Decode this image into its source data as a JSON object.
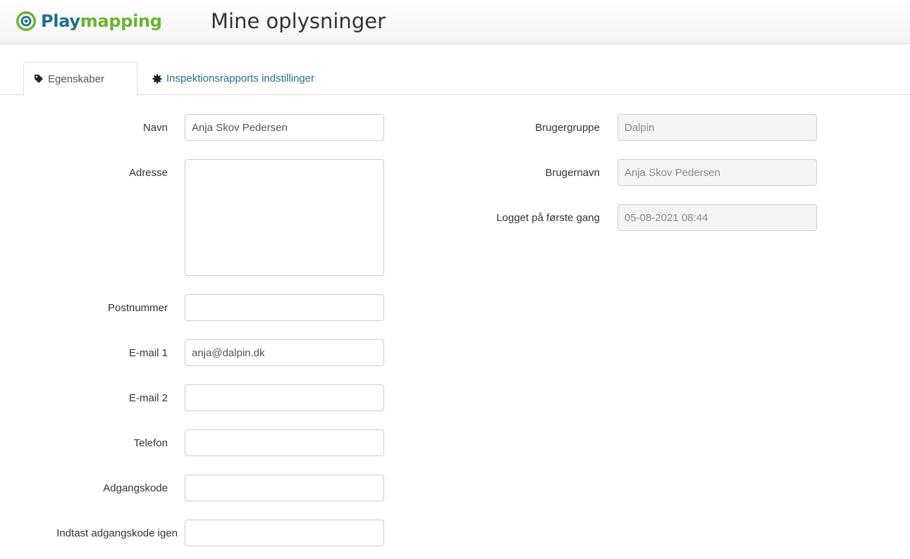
{
  "brand": {
    "part1": "Play",
    "part2": "mapping",
    "color_primary": "#1f6f8b",
    "color_accent": "#6cb332"
  },
  "page_title": "Mine oplysninger",
  "tabs": [
    {
      "label": "Egenskaber",
      "icon": "tag-icon",
      "active": true
    },
    {
      "label": "Inspektionsrapports indstillinger",
      "icon": "gear-icon",
      "active": false
    }
  ],
  "form_left": {
    "navn": {
      "label": "Navn",
      "value": "Anja Skov Pedersen"
    },
    "adresse": {
      "label": "Adresse",
      "value": ""
    },
    "postnummer": {
      "label": "Postnummer",
      "value": ""
    },
    "email1": {
      "label": "E-mail 1",
      "value": "anja@dalpin.dk"
    },
    "email2": {
      "label": "E-mail 2",
      "value": ""
    },
    "telefon": {
      "label": "Telefon",
      "value": ""
    },
    "adgangskode": {
      "label": "Adgangskode",
      "value": ""
    },
    "adgangskode_igen": {
      "label": "Indtast adgangskode igen",
      "value": ""
    }
  },
  "form_right": {
    "brugergruppe": {
      "label": "Brugergruppe",
      "value": "Dalpin"
    },
    "brugernavn": {
      "label": "Brugernavn",
      "value": "Anja Skov Pedersen"
    },
    "logget": {
      "label": "Logget på første gang",
      "value": "05-08-2021 08:44"
    }
  }
}
